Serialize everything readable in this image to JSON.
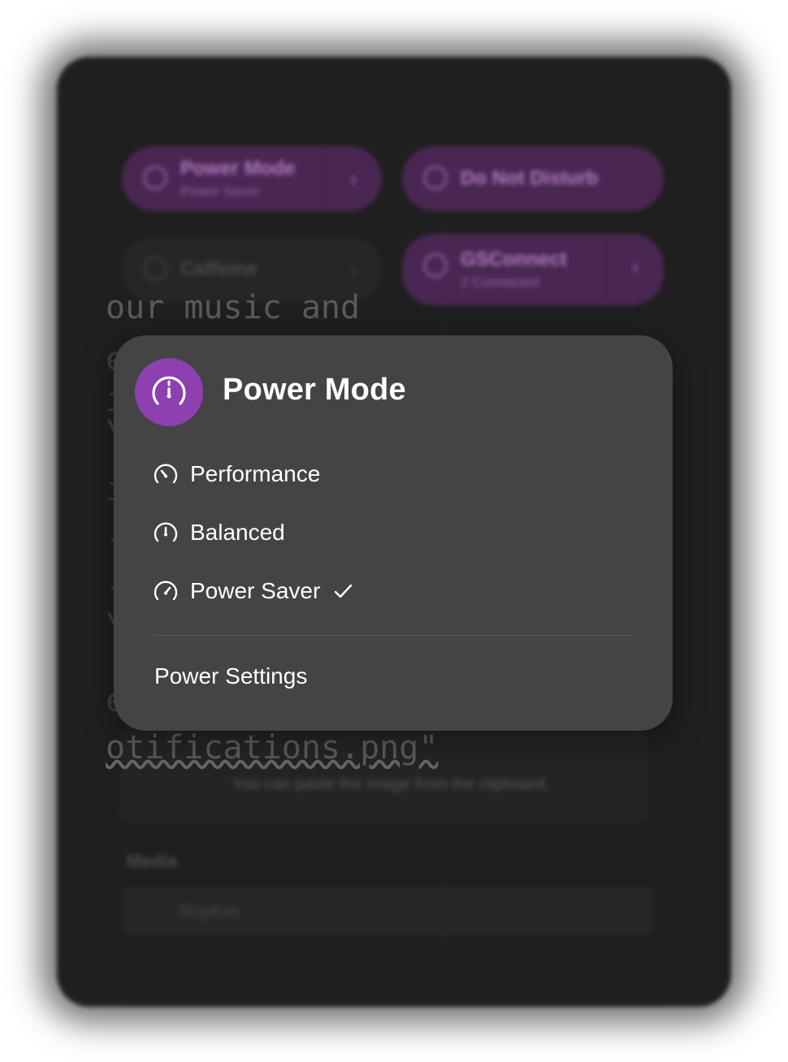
{
  "popover": {
    "title": "Power Mode",
    "accent_color": "#8e3fb0",
    "header_icon": "gauge-icon",
    "options": [
      {
        "label": "Performance",
        "icon": "gauge-high-icon",
        "selected": false
      },
      {
        "label": "Balanced",
        "icon": "gauge-mid-icon",
        "selected": false
      },
      {
        "label": "Power Saver",
        "icon": "gauge-low-icon",
        "selected": true
      }
    ],
    "selected_indicator": "checkmark-icon",
    "settings_link": "Power Settings"
  },
  "background": {
    "tiles": [
      {
        "label": "Power Mode",
        "sub": "Power Saver"
      },
      {
        "label": "Do Not Disturb",
        "sub": ""
      },
      {
        "label": "Caffeine",
        "sub": ""
      },
      {
        "label": "GSConnect",
        "sub": "2 Connected"
      }
    ],
    "text_lines": [
      "our music and",
      "otifications.png\""
    ],
    "stub_chars": [
      "e",
      "i",
      "\\",
      "i",
      "-",
      "-",
      "\\",
      "e"
    ],
    "card_hint": "You can paste the image from the clipboard.",
    "media_label": "Media",
    "media_item": "Rhythm"
  }
}
